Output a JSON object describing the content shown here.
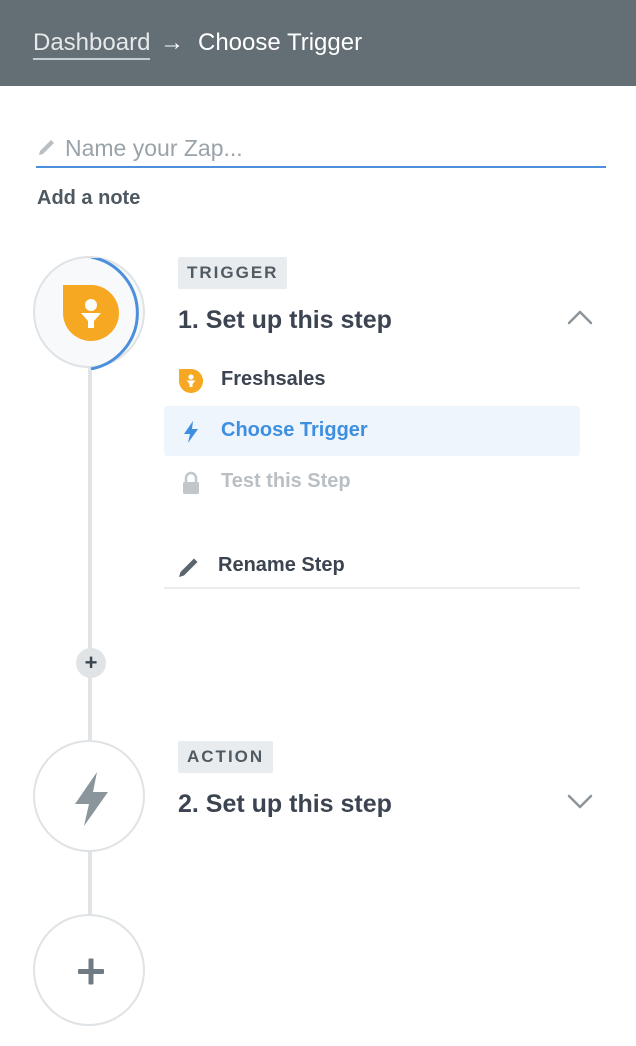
{
  "header": {
    "breadcrumb_link": "Dashboard",
    "breadcrumb_arrow": "→",
    "breadcrumb_current": "Choose Trigger"
  },
  "zap": {
    "name_placeholder": "Name your Zap...",
    "name_value": "",
    "add_note": "Add a note"
  },
  "steps": {
    "trigger": {
      "badge": "TRIGGER",
      "title": "1. Set up this step",
      "expanded": true,
      "app_icon": "freshsales-icon",
      "menu": [
        {
          "label": "Freshsales",
          "icon": "freshsales-icon",
          "state": "done"
        },
        {
          "label": "Choose Trigger",
          "icon": "lightning-icon",
          "state": "selected"
        },
        {
          "label": "Test this Step",
          "icon": "lock-icon",
          "state": "disabled"
        },
        {
          "label": "Rename Step",
          "icon": "pencil-icon",
          "state": "normal"
        }
      ]
    },
    "action": {
      "badge": "ACTION",
      "title": "2. Set up this step",
      "expanded": false,
      "app_icon": "lightning-icon"
    }
  },
  "colors": {
    "header_bg": "#636e75",
    "accent_blue": "#4c8fdc",
    "freshsales_orange": "#f7a823",
    "selected_bg": "#eef5fd"
  }
}
